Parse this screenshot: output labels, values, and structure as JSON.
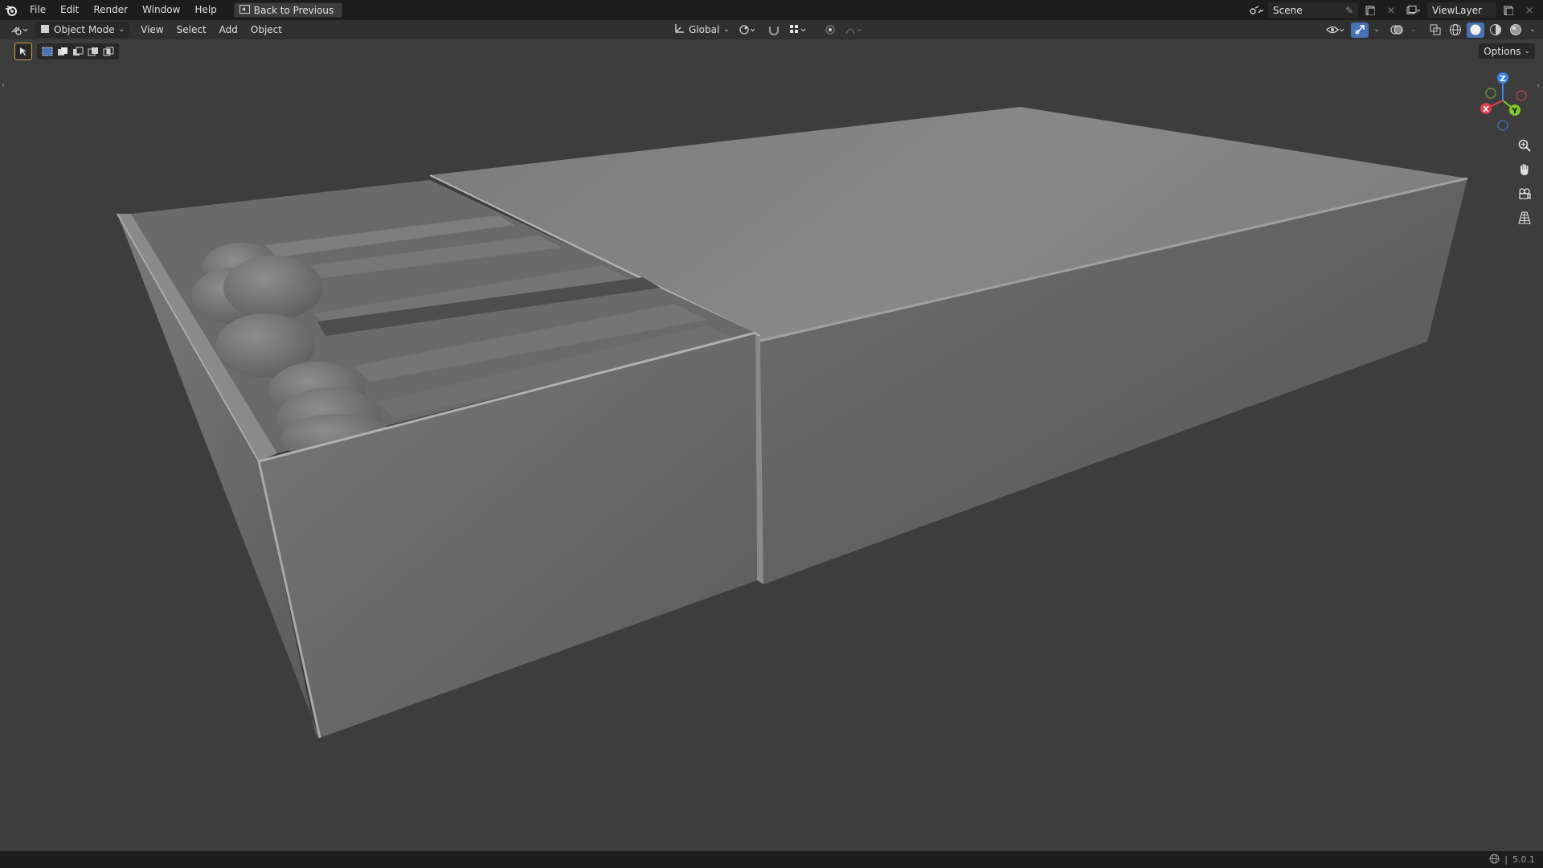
{
  "menu": {
    "items": [
      "File",
      "Edit",
      "Render",
      "Window",
      "Help"
    ],
    "back_button": "Back to Previous"
  },
  "scene": {
    "label": "Scene"
  },
  "view_layer": {
    "label": "ViewLayer"
  },
  "viewport_header": {
    "mode": "Object Mode",
    "menus": [
      "View",
      "Select",
      "Add",
      "Object"
    ],
    "transform_orientation": "Global"
  },
  "options": {
    "label": "Options"
  },
  "gizmo": {
    "z": "Z",
    "y": "Y",
    "x": "X"
  },
  "status": {
    "version": "5.0.1"
  },
  "colors": {
    "axis_x": "#e0404e",
    "axis_y": "#80c82a",
    "axis_z": "#3a86e8",
    "accent": "#4772b3"
  }
}
